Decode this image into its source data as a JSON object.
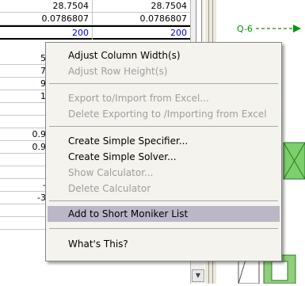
{
  "grid": {
    "rows": [
      {
        "col1": "28.7504",
        "col2": "28.7504"
      },
      {
        "col1": "0.0786807",
        "col2": "0.0786807"
      },
      {
        "col1": "200",
        "col2": "200"
      }
    ],
    "left_stubs": [
      "5",
      "7",
      "9",
      "1",
      "",
      "",
      "0.9",
      "0.9",
      "",
      "",
      "-",
      "-3"
    ]
  },
  "diagram": {
    "stream_label": "Q-6"
  },
  "menu": {
    "items": [
      {
        "label": "Adjust Column Width(s)",
        "enabled": true
      },
      {
        "label": "Adjust Row Height(s)",
        "enabled": false
      },
      {
        "label": "Export to/Import from Excel...",
        "enabled": false
      },
      {
        "label": "Delete Exporting to /Importing from Excel",
        "enabled": false
      },
      {
        "label": "Create Simple Specifier...",
        "enabled": true
      },
      {
        "label": "Create Simple Solver...",
        "enabled": true
      },
      {
        "label": "Show Calculator...",
        "enabled": false
      },
      {
        "label": "Delete Calculator",
        "enabled": false
      },
      {
        "label": "Add to Short Moniker List",
        "enabled": true,
        "highlighted": true
      },
      {
        "label": "What's This?",
        "enabled": true
      }
    ]
  },
  "colors": {
    "menu_highlight": "#bbb7c7",
    "stream_green": "#009900",
    "selected_text": "#0000cc"
  }
}
